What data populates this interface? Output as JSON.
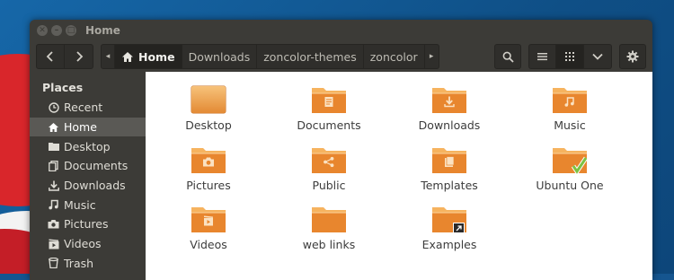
{
  "window": {
    "title": "Home"
  },
  "breadcrumbs": [
    {
      "label": "Home",
      "active": true
    },
    {
      "label": "Downloads",
      "active": false
    },
    {
      "label": "zoncolor-themes",
      "active": false
    },
    {
      "label": "zoncolor",
      "active": false
    }
  ],
  "sidebar": {
    "heading": "Places",
    "items": [
      {
        "label": "Recent",
        "icon": "clock-icon"
      },
      {
        "label": "Home",
        "icon": "home-icon",
        "selected": true
      },
      {
        "label": "Desktop",
        "icon": "desktop-folder-icon"
      },
      {
        "label": "Documents",
        "icon": "documents-icon"
      },
      {
        "label": "Downloads",
        "icon": "download-icon"
      },
      {
        "label": "Music",
        "icon": "music-icon"
      },
      {
        "label": "Pictures",
        "icon": "camera-icon"
      },
      {
        "label": "Videos",
        "icon": "film-icon"
      },
      {
        "label": "Trash",
        "icon": "trash-icon"
      }
    ]
  },
  "files": [
    {
      "label": "Desktop",
      "emblem": "desktop"
    },
    {
      "label": "Documents",
      "emblem": "document"
    },
    {
      "label": "Downloads",
      "emblem": "download"
    },
    {
      "label": "Music",
      "emblem": "music"
    },
    {
      "label": "Pictures",
      "emblem": "camera"
    },
    {
      "label": "Public",
      "emblem": "share"
    },
    {
      "label": "Templates",
      "emblem": "template"
    },
    {
      "label": "Ubuntu One",
      "emblem": "check"
    },
    {
      "label": "Videos",
      "emblem": "film"
    },
    {
      "label": "web links",
      "emblem": "none"
    },
    {
      "label": "Examples",
      "emblem": "link"
    }
  ],
  "colors": {
    "folder_top": "#f6b35f",
    "folder_body": "#e8862e",
    "emblem": "#fbe2c2",
    "check": "#7cc242"
  }
}
